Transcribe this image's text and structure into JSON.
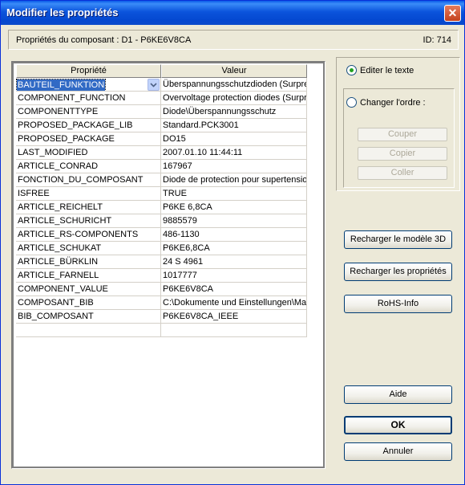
{
  "window": {
    "title": "Modifier les propriétés"
  },
  "info": {
    "component_label": "Propriétés du composant : D1 - P6KE6V8CA",
    "id_label": "ID: 714"
  },
  "grid": {
    "headers": [
      "Propriété",
      "Valeur"
    ],
    "selected_row": 0,
    "rows": [
      [
        "BAUTEIL_FUNKTION",
        "Überspannungsschutzdioden (Surpresso"
      ],
      [
        "COMPONENT_FUNCTION",
        "Overvoltage protection diodes (Surpres"
      ],
      [
        "COMPONENTTYPE",
        "Diode\\Überspannungsschutz"
      ],
      [
        "PROPOSED_PACKAGE_LIB",
        "Standard.PCK3001"
      ],
      [
        "PROPOSED_PACKAGE",
        "DO15"
      ],
      [
        "LAST_MODIFIED",
        "2007.01.10 11:44:11"
      ],
      [
        "ARTICLE_CONRAD",
        "167967"
      ],
      [
        "FONCTION_DU_COMPOSANT",
        "Diode de protection pour supertension"
      ],
      [
        "ISFREE",
        "TRUE"
      ],
      [
        "ARTICLE_REICHELT",
        "P6KE 6,8CA"
      ],
      [
        "ARTICLE_SCHURICHT",
        "9885579"
      ],
      [
        "ARTICLE_RS-COMPONENTS",
        "486-1130"
      ],
      [
        "ARTICLE_SCHUKAT",
        "P6KE6,8CA"
      ],
      [
        "ARTICLE_BÜRKLIN",
        "24 S 4961"
      ],
      [
        "ARTICLE_FARNELL",
        "1017777"
      ],
      [
        "COMPONENT_VALUE",
        "P6KE6V8CA"
      ],
      [
        "COMPOSANT_BIB",
        "C:\\Dokumente und Einstellungen\\Ma"
      ],
      [
        "BIB_COMPOSANT",
        "P6KE6V8CA_IEEE"
      ],
      [
        "",
        ""
      ]
    ]
  },
  "options": {
    "edit_text_label": "Editer le texte",
    "edit_text_checked": true,
    "change_order_label": "Changer l'ordre :",
    "change_order_checked": false,
    "cut_label": "Couper",
    "copy_label": "Copier",
    "paste_label": "Coller"
  },
  "buttons": {
    "reload_3d": "Recharger le modèle 3D",
    "reload_props": "Recharger les propriétés",
    "rohs": "RoHS-Info",
    "help": "Aide",
    "ok": "OK",
    "cancel": "Annuler"
  }
}
